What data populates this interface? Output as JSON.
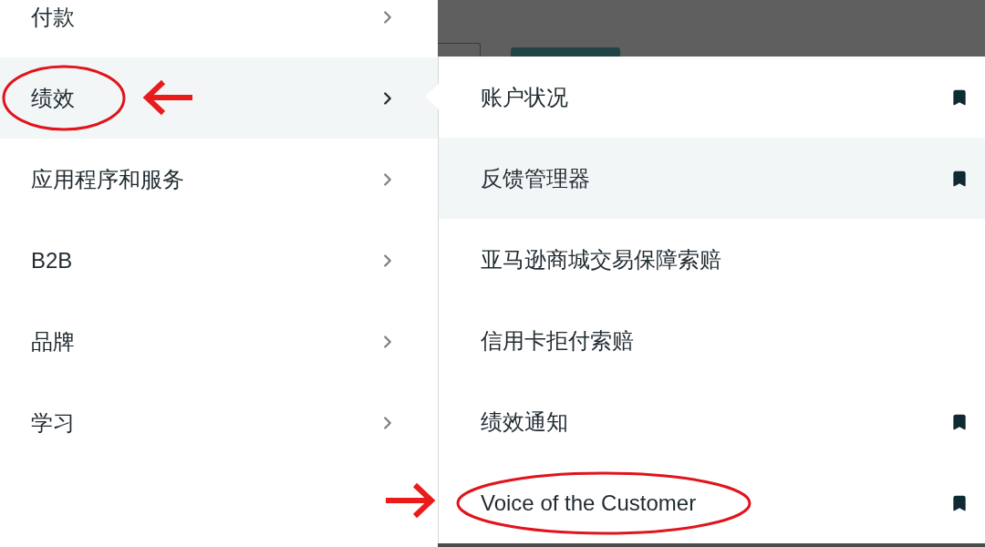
{
  "menu": {
    "items": [
      {
        "label": "付款",
        "selected": false,
        "annotated": false
      },
      {
        "label": "绩效",
        "selected": true,
        "annotated": true
      },
      {
        "label": "应用程序和服务",
        "selected": false,
        "annotated": false
      },
      {
        "label": "B2B",
        "selected": false,
        "annotated": false
      },
      {
        "label": "品牌",
        "selected": false,
        "annotated": false
      },
      {
        "label": "学习",
        "selected": false,
        "annotated": false
      }
    ]
  },
  "submenu": {
    "items": [
      {
        "label": "账户状况",
        "selected": false,
        "bookmarked": true,
        "annotated": false
      },
      {
        "label": "反馈管理器",
        "selected": true,
        "bookmarked": true,
        "annotated": false
      },
      {
        "label": "亚马逊商城交易保障索赔",
        "selected": false,
        "bookmarked": false,
        "annotated": false
      },
      {
        "label": "信用卡拒付索赔",
        "selected": false,
        "bookmarked": false,
        "annotated": false
      },
      {
        "label": "绩效通知",
        "selected": false,
        "bookmarked": true,
        "annotated": false
      },
      {
        "label": "Voice of the Customer",
        "selected": false,
        "bookmarked": true,
        "annotated": true
      }
    ]
  }
}
